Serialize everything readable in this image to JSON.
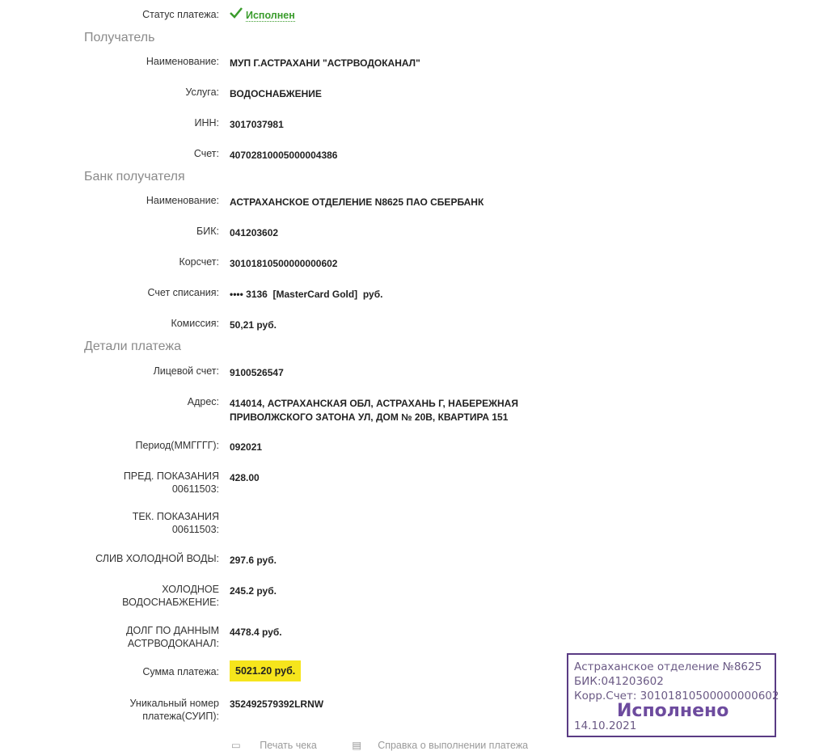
{
  "status": {
    "label": "Статус платежа:",
    "value": "Исполнен"
  },
  "sections": {
    "recipient": "Получатель",
    "bank": "Банк получателя",
    "details": "Детали платежа"
  },
  "recipient": {
    "name_label": "Наименование:",
    "name": "МУП Г.АСТРАХАНИ \"АСТРВОДОКАНАЛ\"",
    "service_label": "Услуга:",
    "service": "ВОДОСНАБЖЕНИЕ",
    "inn_label": "ИНН:",
    "inn": "3017037981",
    "account_label": "Счет:",
    "account": "40702810005000004386"
  },
  "bank": {
    "name_label": "Наименование:",
    "name": "АСТРАХАНСКОЕ ОТДЕЛЕНИЕ N8625 ПАО СБЕРБАНК",
    "bik_label": "БИК:",
    "bik": "041203602",
    "corr_label": "Корсчет:",
    "corr": "30101810500000000602",
    "debit_label": "Счет списания:",
    "debit": "•••• 3136  [MasterCard Gold]  руб.",
    "fee_label": "Комиссия:",
    "fee": "50,21 руб."
  },
  "details": {
    "personal_label": "Лицевой счет:",
    "personal": "9100526547",
    "address_label": "Адрес:",
    "address_line1": "414014, АСТРАХАНСКАЯ ОБЛ, АСТРАХАНЬ Г, НАБЕРЕЖНАЯ",
    "address_line2": "ПРИВОЛЖСКОГО ЗАТОНА УЛ, ДОМ № 20В, КВАРТИРА 151",
    "period_label": "Период(ММГГГГ):",
    "period": "092021",
    "prev_label1": "ПРЕД. ПОКАЗАНИЯ",
    "prev_label2": "00611503:",
    "prev": "428.00",
    "cur_label1": "ТЕК. ПОКАЗАНИЯ",
    "cur_label2": "00611503:",
    "drain_label": "СЛИВ ХОЛОДНОЙ ВОДЫ:",
    "drain": "297.6 руб.",
    "cold_label1": "ХОЛОДНОЕ",
    "cold_label2": "ВОДОСНАБЖЕНИЕ:",
    "cold": "245.2 руб.",
    "debt_label1": "ДОЛГ ПО ДАННЫМ",
    "debt_label2": "АСТРВОДОКАНАЛ:",
    "debt": "4478.4 руб.",
    "sum_label": "Сумма платежа:",
    "sum": "5021.20 руб.",
    "uid_label1": "Уникальный номер",
    "uid_label2": "платежа(СУИП):",
    "uid": "352492579392LRNW"
  },
  "stamp": {
    "line1": "Астраханское отделение №8625",
    "line2": "БИК:041203602",
    "line3": "Корр.Счет: 30101810500000000602",
    "big": "Исполнено",
    "date": "14.10.2021"
  },
  "bottom": {
    "print": "Печать чека",
    "certificate": "Справка о выполнении платежа"
  },
  "colors": {
    "accent": "#3a9c2c",
    "highlight": "#f6e51c",
    "stamp": "#5a3b84"
  }
}
